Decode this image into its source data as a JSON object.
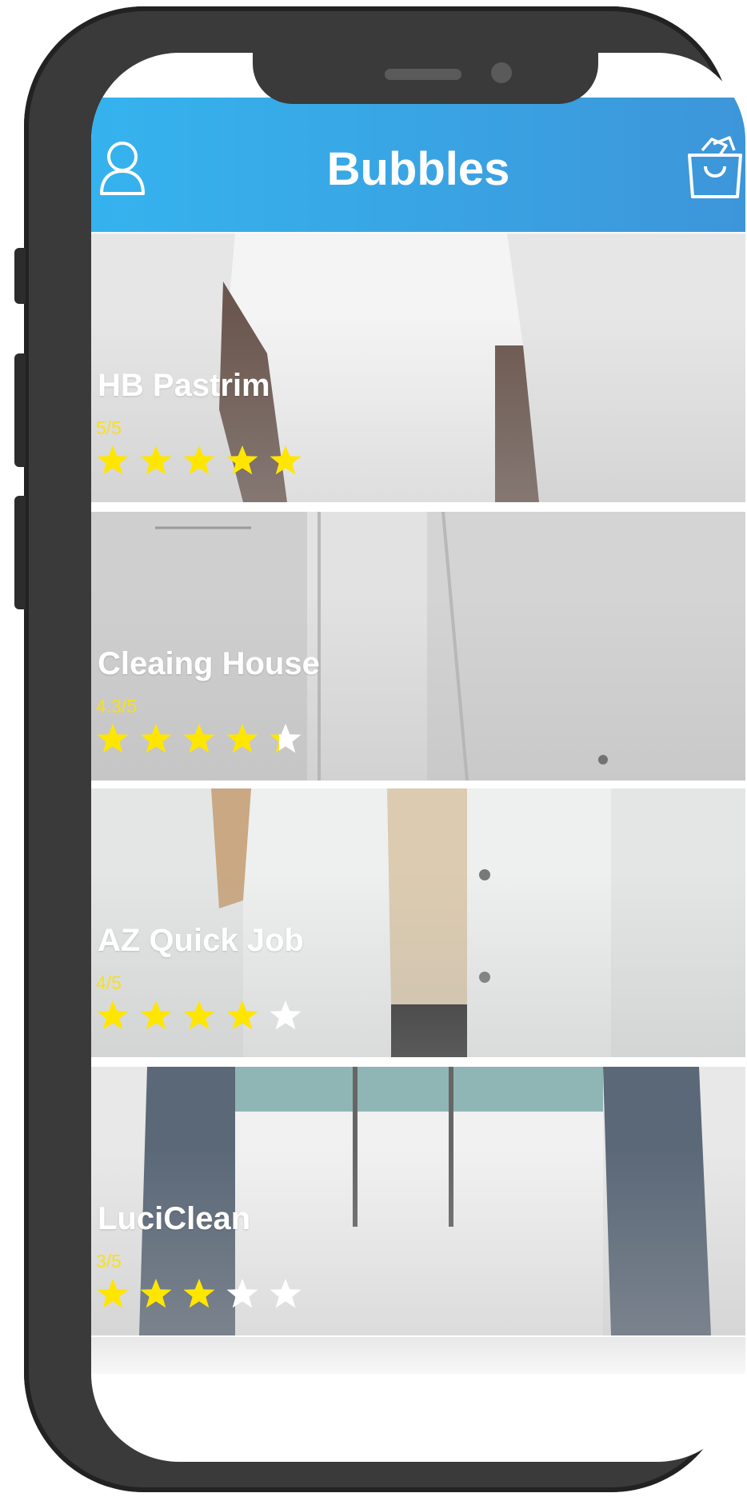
{
  "app": {
    "title": "Bubbles"
  },
  "header": {
    "profile_icon": "user-icon",
    "cart_icon": "shopping-bag-icon"
  },
  "colors": {
    "header_start": "#35b3ee",
    "header_end": "#3d96d9",
    "star_filled": "#ffe600",
    "star_empty": "#ffffff",
    "score_text": "#f6e01c"
  },
  "shops": [
    {
      "name": "HB Pastrim",
      "rating_text": "5/5",
      "rating": 5
    },
    {
      "name": "Cleaing House",
      "rating_text": "4.3/5",
      "rating": 4.3
    },
    {
      "name": "AZ Quick Job",
      "rating_text": "4/5",
      "rating": 4
    },
    {
      "name": "LuciClean",
      "rating_text": "3/5",
      "rating": 3
    }
  ]
}
